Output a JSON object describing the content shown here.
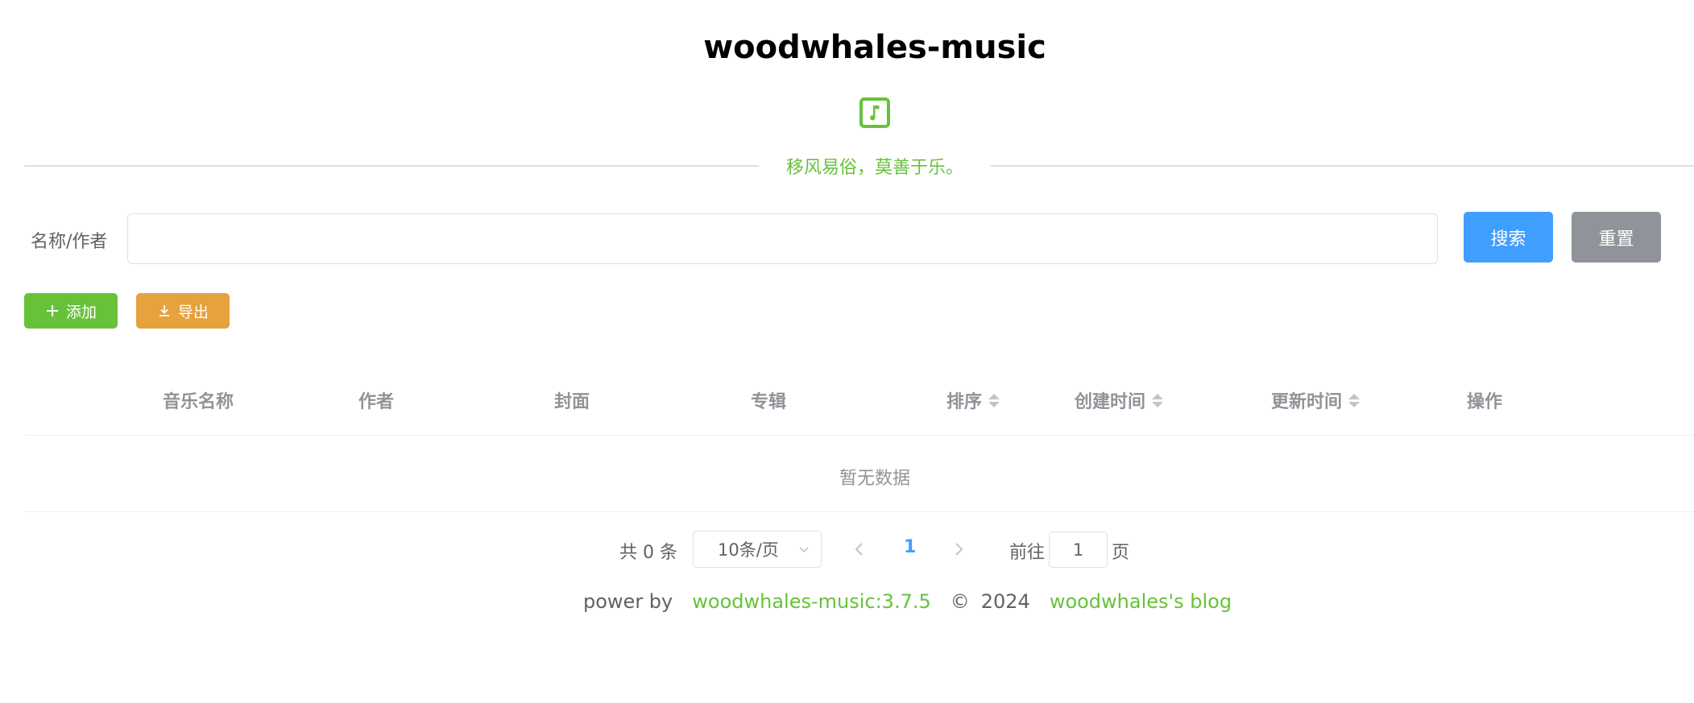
{
  "app": {
    "title": "woodwhales-music",
    "logo_icon": "music-note-icon",
    "slogan": "移风易俗，莫善于乐。",
    "accent_color": "#67c23a"
  },
  "search": {
    "label": "名称/作者",
    "value": "",
    "placeholder": "",
    "search_button": "搜索",
    "reset_button": "重置"
  },
  "toolbar": {
    "add_label": "添加",
    "add_icon": "plus-icon",
    "export_label": "导出",
    "export_icon": "download-icon"
  },
  "table": {
    "columns": [
      {
        "label": "音乐名称",
        "sortable": false
      },
      {
        "label": "作者",
        "sortable": false
      },
      {
        "label": "封面",
        "sortable": false
      },
      {
        "label": "专辑",
        "sortable": false
      },
      {
        "label": "排序",
        "sortable": true
      },
      {
        "label": "创建时间",
        "sortable": true
      },
      {
        "label": "更新时间",
        "sortable": true
      },
      {
        "label": "操作",
        "sortable": false
      }
    ],
    "rows": [],
    "empty_text": "暂无数据"
  },
  "pagination": {
    "total_text": "共 0 条",
    "page_size": "10条/页",
    "current_page": "1",
    "goto_label": "前往",
    "goto_value": "1",
    "page_suffix": "页"
  },
  "footer": {
    "power_by": "power by",
    "version_link": "woodwhales-music:3.7.5",
    "copyright": "©",
    "year": "2024",
    "blog_link": "woodwhales's blog"
  }
}
